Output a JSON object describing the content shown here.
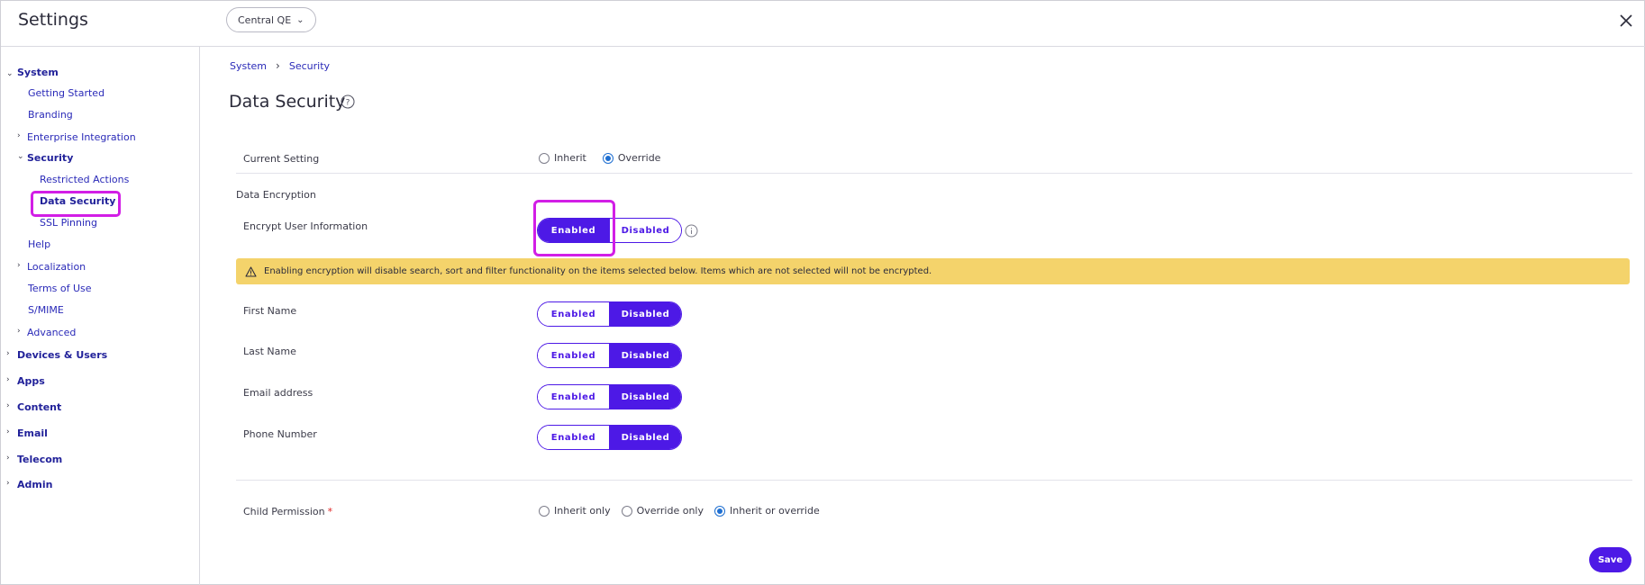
{
  "app": {
    "title": "Settings",
    "org": "Central QE"
  },
  "sidebar": {
    "system": "System",
    "getting_started": "Getting Started",
    "branding": "Branding",
    "enterprise_integration": "Enterprise Integration",
    "security": "Security",
    "restricted_actions": "Restricted Actions",
    "data_security": "Data Security",
    "ssl_pinning": "SSL Pinning",
    "help": "Help",
    "localization": "Localization",
    "terms_of_use": "Terms of Use",
    "smime": "S/MIME",
    "advanced": "Advanced",
    "devices_users": "Devices & Users",
    "apps": "Apps",
    "content": "Content",
    "email": "Email",
    "telecom": "Telecom",
    "admin": "Admin"
  },
  "breadcrumb": {
    "first": "System",
    "second": "Security"
  },
  "page": {
    "title": "Data Security"
  },
  "current_setting": {
    "label": "Current Setting",
    "options": [
      "Inherit",
      "Override"
    ],
    "selected": "Override"
  },
  "encryption": {
    "section_label": "Data Encryption",
    "label": "Encrypt User Information",
    "enabled_label": "Enabled",
    "disabled_label": "Disabled",
    "state": "Enabled"
  },
  "warning": {
    "text": "Enabling encryption will disable search, sort and filter functionality on the items selected below. Items which are not selected will not be encrypted."
  },
  "fields": [
    {
      "label": "First Name",
      "state": "Disabled"
    },
    {
      "label": "Last Name",
      "state": "Disabled"
    },
    {
      "label": "Email address",
      "state": "Disabled"
    },
    {
      "label": "Phone Number",
      "state": "Disabled"
    }
  ],
  "toggle_labels": {
    "enabled": "Enabled",
    "disabled": "Disabled"
  },
  "child_permission": {
    "label": "Child Permission",
    "required_mark": "*",
    "options": [
      "Inherit only",
      "Override only",
      "Inherit or override"
    ],
    "selected": "Inherit or override"
  },
  "save_label": "Save",
  "colors": {
    "accent": "#4d19e6",
    "highlight": "#d21ee6",
    "warning_bg": "#f4d36b",
    "link": "#2a2ab8"
  }
}
